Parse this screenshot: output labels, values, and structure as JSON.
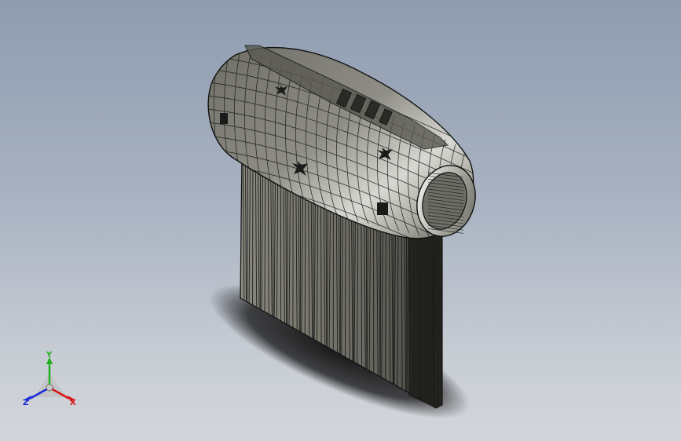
{
  "viewport": {
    "background_top": "#8f9cb0",
    "background_bottom": "#d3d6db"
  },
  "model": {
    "shade_color": "#8d8c84",
    "edge_color": "#111111",
    "shadow_color": "#111111"
  },
  "triad": {
    "x_label": "X",
    "y_label": "Y",
    "z_label": "Z",
    "x_color": "#d61515",
    "y_color": "#1fae1f",
    "z_color": "#1a2ad6"
  }
}
